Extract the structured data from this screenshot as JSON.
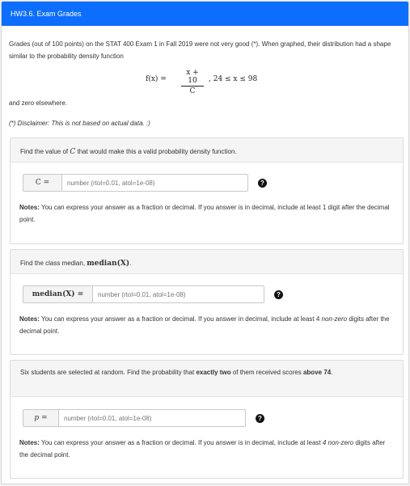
{
  "header": {
    "title": "HW3.6. Exam Grades"
  },
  "intro": {
    "text": "Grades (out of 100 points) on the STAT 400 Exam 1 in Fall 2019 were not very good (*). When graphed, their distribution had a shape similar to the probability density function",
    "formula_lhs": "f(x) =",
    "formula_num": "x + 10",
    "formula_den": "C",
    "formula_range": ",    24 ≤ x ≤ 98",
    "zero_text": "and zero elsewhere.",
    "disclaimer": "(*) Disclaimer: This is not based on actual data. :)"
  },
  "parts": [
    {
      "prompt_prefix": "Find the value of ",
      "prompt_math": "C",
      "prompt_suffix": " that would make this a valid probability density function.",
      "var_label": "C =",
      "input_placeholder": "number (rtol=0.01, atol=1e-08)",
      "input_value": "",
      "notes_label": "Notes:",
      "notes_text_1": " You can express your answer as a fraction or decimal. If you answer is in decimal, include at least 1 digit after the decimal point.",
      "notes_italic": "",
      "notes_text_2": ""
    },
    {
      "prompt_prefix": "Find the class median, ",
      "prompt_math": "median(X)",
      "prompt_suffix": ".",
      "var_label": "median(X) =",
      "input_placeholder": "number (rtol=0.01, atol=1e-08)",
      "input_value": "",
      "notes_label": "Notes:",
      "notes_text_1": " You can express your answer as a fraction or decimal. If you answer in decimal, include at least 4 ",
      "notes_italic": "non-zero",
      "notes_text_2": " digits after the decimal point."
    },
    {
      "prompt_prefix": "Six students are selected at random. Find the probability that ",
      "prompt_bold": "exactly two",
      "prompt_mid": " of them received scores ",
      "prompt_bold2": "above 74",
      "prompt_suffix": ".",
      "var_label": "p =",
      "input_placeholder": "number (rtol=0.01, atol=1e-08)",
      "input_value": "",
      "notes_label": "Notes:",
      "notes_text_1": " You can express your answer as a fraction or decimal. If you answer is in decimal, include at least ",
      "notes_italic": "4 non-zero",
      "notes_text_2": " digits after the decimal point."
    }
  ],
  "icons": {
    "help": "question-circle-icon"
  },
  "colors": {
    "header_bg": "#0d6efd",
    "help_icon": "#111111"
  }
}
